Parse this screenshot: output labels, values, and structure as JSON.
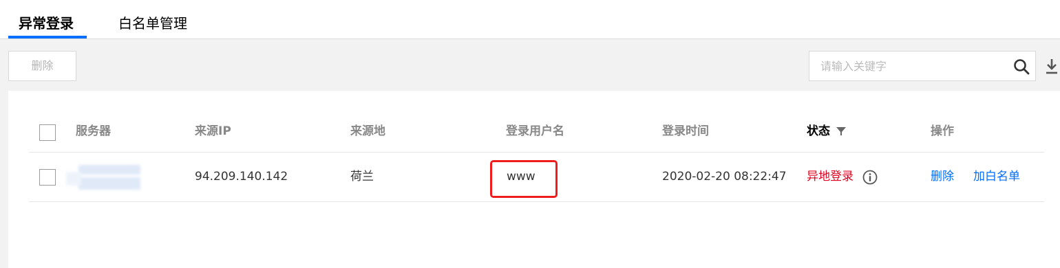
{
  "tabs": [
    {
      "label": "异常登录",
      "active": true
    },
    {
      "label": "白名单管理",
      "active": false
    }
  ],
  "toolbar": {
    "delete_label": "删除",
    "search_placeholder": "请输入关键字"
  },
  "table": {
    "columns": {
      "server": "服务器",
      "source_ip": "来源IP",
      "source_location": "来源地",
      "login_user": "登录用户名",
      "login_time": "登录时间",
      "status": "状态",
      "actions": "操作"
    },
    "rows": [
      {
        "source_ip": "94.209.140.142",
        "source_location": "荷兰",
        "login_user": "www",
        "login_time": "2020-02-20 08:22:47",
        "status": "异地登录",
        "action_delete": "删除",
        "action_whitelist": "加白名单"
      }
    ]
  },
  "icons": {
    "search": "search-icon",
    "download": "download-icon",
    "filter": "filter-icon",
    "info": "info-icon"
  },
  "colors": {
    "accent": "#006eff",
    "alert": "#e1001e",
    "annotation": "#ee1c1c"
  }
}
